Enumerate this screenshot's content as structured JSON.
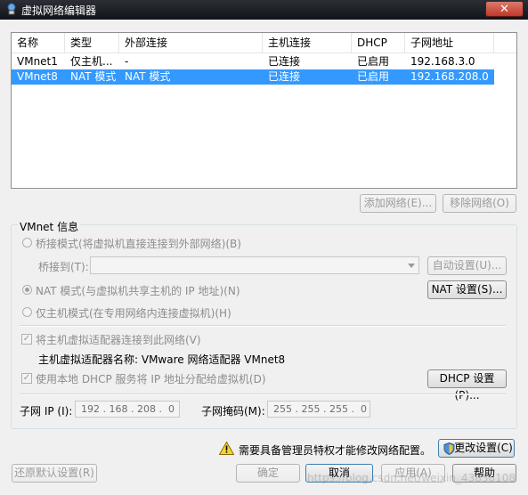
{
  "window": {
    "title": "虚拟网络编辑器",
    "close_label": "✕"
  },
  "table": {
    "columns": [
      "名称",
      "类型",
      "外部连接",
      "主机连接",
      "DHCP",
      "子网地址"
    ],
    "rows": [
      {
        "name": "VMnet1",
        "type": "仅主机...",
        "external": "-",
        "host": "已连接",
        "dhcp": "已启用",
        "subnet": "192.168.3.0",
        "selected": false
      },
      {
        "name": "VMnet8",
        "type": "NAT 模式",
        "external": "NAT 模式",
        "host": "已连接",
        "dhcp": "已启用",
        "subnet": "192.168.208.0",
        "selected": true
      }
    ]
  },
  "list_buttons": {
    "add": "添加网络(E)...",
    "remove": "移除网络(O)"
  },
  "vmnet_info": {
    "label": "VMnet 信息",
    "bridge_mode": "桥接模式(将虚拟机直接连接到外部网络)(B)",
    "bridge_to_label": "桥接到(T):",
    "auto_settings": "自动设置(U)...",
    "nat_mode": "NAT 模式(与虚拟机共享主机的 IP 地址)(N)",
    "nat_settings": "NAT 设置(S)...",
    "host_only_mode": "仅主机模式(在专用网络内连接虚拟机)(H)",
    "connect_adapter": "将主机虚拟适配器连接到此网络(V)",
    "adapter_name": "主机虚拟适配器名称: VMware 网络适配器 VMnet8",
    "use_dhcp": "使用本地 DHCP 服务将 IP 地址分配给虚拟机(D)",
    "dhcp_settings": "DHCP 设置(P)...",
    "subnet_ip_label": "子网 IP (I):",
    "subnet_ip": "192 . 168 . 208 .  0",
    "subnet_mask_label": "子网掩码(M):",
    "subnet_mask": "255 . 255 . 255 .  0"
  },
  "admin_notice": "需要具备管理员特权才能修改网络配置。",
  "change_settings": "更改设置(C)",
  "footer": {
    "restore": "还原默认设置(R)",
    "ok": "确定",
    "cancel": "取消",
    "apply": "应用(A)",
    "help": "帮助"
  },
  "watermark": "https://blog.csdn.net/weixin_43838108"
}
